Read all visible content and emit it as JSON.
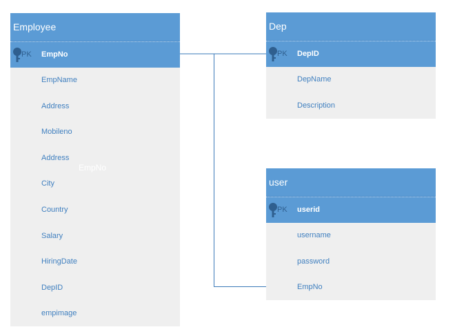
{
  "colors": {
    "header_bg": "#5b9bd5",
    "body_bg": "#efefef",
    "field_text": "#3f7fbf",
    "line": "#3a78b8"
  },
  "key_icon": "key-icon",
  "entities": {
    "employee": {
      "title": "Employee",
      "pk": {
        "tag": "PK",
        "name": "EmpNo"
      },
      "fields": [
        "EmpName",
        "Address",
        "Mobileno",
        "Address",
        "City",
        "Country",
        "Salary",
        "HiringDate",
        "DepID",
        "empimage"
      ]
    },
    "dep": {
      "title": "Dep",
      "pk": {
        "tag": "PK",
        "name": "DepID"
      },
      "fields": [
        "DepName",
        "Description"
      ]
    },
    "user": {
      "title": "user",
      "pk": {
        "tag": "PK",
        "name": "userid"
      },
      "fields": [
        "username",
        "password",
        "EmpNo"
      ]
    }
  },
  "overlay_text": "EmpNo",
  "relationships": [
    {
      "from": "Employee.EmpNo",
      "to": "Dep.DepID"
    },
    {
      "from": "Employee.EmpNo",
      "to": "user.EmpNo"
    }
  ]
}
